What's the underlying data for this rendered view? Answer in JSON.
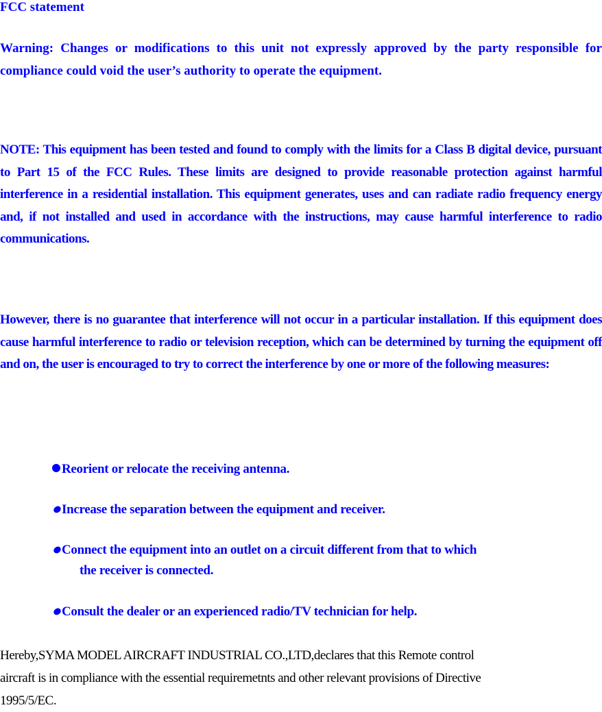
{
  "title": "FCC statement",
  "warning": "Warning: Changes or modifications to this unit not expressly approved by the party responsible for compliance could void the user’s authority to operate the equipment.",
  "note": "NOTE: This equipment has been tested and found to comply with the limits for a Class B digital device, pursuant to Part 15 of the FCC Rules. These limits are designed to provide reasonable protection against harmful interference in a residential installation. This equipment generates, uses and can radiate radio frequency energy and, if not installed and used in accordance with the instructions, may cause harmful interference to radio communications.",
  "however": "However, there is no guarantee that interference will not occur in a particular installation.  If this equipment does cause harmful interference to radio or television reception, which can be determined by turning the equipment off and on, the user is encouraged to try to correct the interference by one or more of the following measures:",
  "measures": [
    {
      "text": "Reorient or relocate the receiving antenna."
    },
    {
      "text": "Increase the separation between the equipment and receiver."
    },
    {
      "text": "Connect the equipment into an outlet on a circuit different from that to which",
      "continuation": "the receiver is connected."
    },
    {
      "text": "Consult the dealer or an experienced radio/TV technician for help."
    }
  ],
  "declaration": {
    "line1": "Hereby,SYMA MODEL AIRCRAFT INDUSTRIAL CO.,LTD,declares that this Remote control",
    "line2": "aircraft is in compliance with the essential requiremetnts and other relevant provisions of Directive",
    "line3": "1995/5/EC."
  },
  "colors": {
    "text_accent": "#0000ff",
    "body_text": "#000000",
    "background": "#ffffff"
  }
}
